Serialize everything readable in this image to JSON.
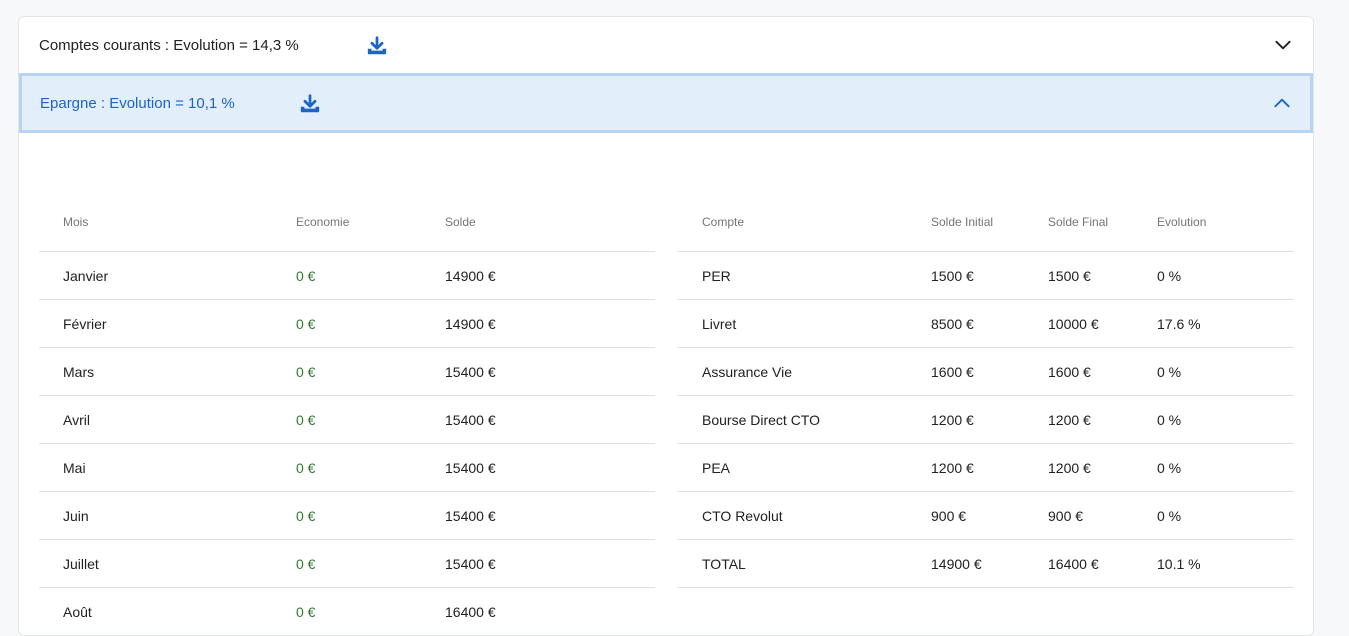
{
  "accordion": {
    "comptes_courants": {
      "title": "Comptes courants : Evolution = 14,3 %",
      "icon": "download-icon",
      "chevron": "chevron-down-icon"
    },
    "epargne": {
      "title": "Epargne : Evolution = 10,1 %",
      "icon": "download-icon",
      "chevron": "chevron-up-icon"
    }
  },
  "colors": {
    "accent": "#1c64c8",
    "expanded_bg": "#e3eefb",
    "positive": "#2e7d32"
  },
  "monthly_table": {
    "headers": [
      "Mois",
      "Economie",
      "Solde"
    ],
    "rows": [
      [
        "Janvier",
        "0 €",
        "14900 €"
      ],
      [
        "Février",
        "0 €",
        "14900 €"
      ],
      [
        "Mars",
        "0 €",
        "15400 €"
      ],
      [
        "Avril",
        "0 €",
        "15400 €"
      ],
      [
        "Mai",
        "0 €",
        "15400 €"
      ],
      [
        "Juin",
        "0 €",
        "15400 €"
      ],
      [
        "Juillet",
        "0 €",
        "15400 €"
      ],
      [
        "Août",
        "0 €",
        "16400 €"
      ]
    ]
  },
  "accounts_table": {
    "headers": [
      "Compte",
      "Solde Initial",
      "Solde Final",
      "Evolution"
    ],
    "rows": [
      [
        "PER",
        "1500 €",
        "1500 €",
        "0 %"
      ],
      [
        "Livret",
        "8500 €",
        "10000 €",
        "17.6 %"
      ],
      [
        "Assurance Vie",
        "1600 €",
        "1600 €",
        "0 %"
      ],
      [
        "Bourse Direct CTO",
        "1200 €",
        "1200 €",
        "0 %"
      ],
      [
        "PEA",
        "1200 €",
        "1200 €",
        "0 %"
      ],
      [
        "CTO Revolut",
        "900 €",
        "900 €",
        "0 %"
      ],
      [
        "TOTAL",
        "14900 €",
        "16400 €",
        "10.1 %"
      ]
    ]
  }
}
